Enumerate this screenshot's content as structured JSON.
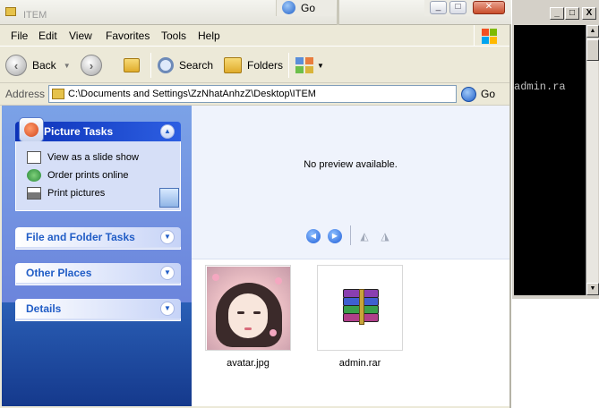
{
  "background_window": {
    "title": "ITEM",
    "go_label": "Go",
    "controls": {
      "minimize": "_",
      "restore": "□",
      "close": "✕"
    }
  },
  "console": {
    "controls": {
      "minimize": "_",
      "restore": "□",
      "close": "X"
    },
    "text": "admin.ra"
  },
  "menu": [
    "File",
    "Edit",
    "View",
    "Favorites",
    "Tools",
    "Help"
  ],
  "toolbar": {
    "back_label": "Back",
    "search_label": "Search",
    "folders_label": "Folders"
  },
  "address": {
    "label": "Address",
    "value": "C:\\Documents and Settings\\ZzNhatAnhzZ\\Desktop\\ITEM",
    "go_label": "Go"
  },
  "tasks": {
    "picture_tasks": {
      "title": "Picture Tasks",
      "items": [
        "View as a slide show",
        "Order prints online",
        "Print pictures"
      ]
    },
    "file_folder_tasks": {
      "title": "File and Folder Tasks"
    },
    "other_places": {
      "title": "Other Places"
    },
    "details": {
      "title": "Details"
    }
  },
  "preview": {
    "message": "No preview available."
  },
  "files": [
    {
      "name": "avatar.jpg",
      "icon": "image-thumbnail"
    },
    {
      "name": "admin.rar",
      "icon": "winrar-archive-icon"
    }
  ],
  "colors": {
    "task_pane_top": "#7ba2e7",
    "task_pane_bottom": "#15398c",
    "panel_header_text": "#215dc6",
    "preview_background": "#eff3fc"
  }
}
